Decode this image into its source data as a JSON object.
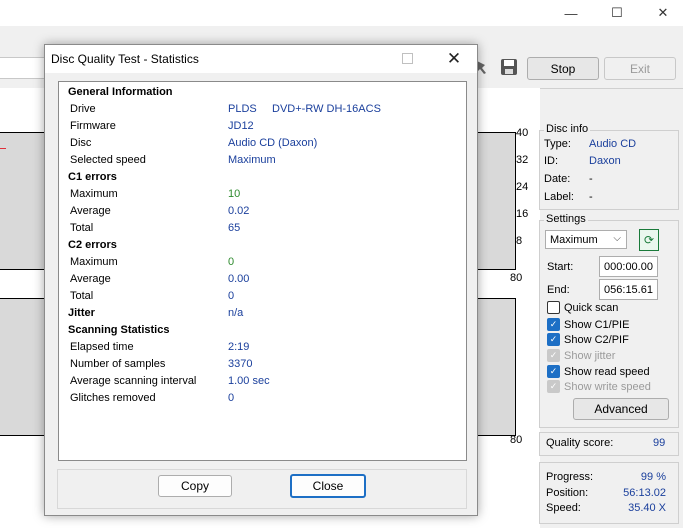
{
  "main_window": {
    "controls": {
      "minimize": "—",
      "maximize": "☐",
      "close": "✕"
    },
    "stop_label": "Stop",
    "exit_label": "Exit",
    "graph_top_ticks": [
      "40",
      "32",
      "24",
      "16",
      "8"
    ],
    "graph_top_bottom": "80",
    "graph_bottom_tick": "80"
  },
  "disc_info": {
    "title": "Disc info",
    "rows": [
      {
        "label": "Type:",
        "value": "Audio CD"
      },
      {
        "label": "ID:",
        "value": "Daxon"
      },
      {
        "label": "Date:",
        "value": "-"
      },
      {
        "label": "Label:",
        "value": "-"
      }
    ]
  },
  "settings": {
    "title": "Settings",
    "speed_selected": "Maximum",
    "start_label": "Start:",
    "start_value": "000:00.00",
    "end_label": "End:",
    "end_value": "056:15.61",
    "quick_scan": "Quick scan",
    "show_c1": "Show C1/PIE",
    "show_c2": "Show C2/PIF",
    "show_jitter": "Show jitter",
    "show_read_speed": "Show read speed",
    "show_write_speed": "Show write speed",
    "advanced_label": "Advanced"
  },
  "quality": {
    "label": "Quality score:",
    "value": "99"
  },
  "progress": {
    "progress_label": "Progress:",
    "progress_value": "99 %",
    "position_label": "Position:",
    "position_value": "56:13.02",
    "speed_label": "Speed:",
    "speed_value": "35.40 X"
  },
  "dialog": {
    "title": "Disc Quality Test - Statistics",
    "close": "✕",
    "general_header": "General Information",
    "drive_label": "Drive",
    "drive_value": "PLDS     DVD+-RW DH-16ACS",
    "firmware_label": "Firmware",
    "firmware_value": "JD12",
    "disc_label": "Disc",
    "disc_value": "Audio CD (Daxon)",
    "speed_label": "Selected speed",
    "speed_value": "Maximum",
    "c1_header": "C1 errors",
    "c1_max_label": "Maximum",
    "c1_max_value": "10",
    "c1_avg_label": "Average",
    "c1_avg_value": "0.02",
    "c1_total_label": "Total",
    "c1_total_value": "65",
    "c2_header": "C2 errors",
    "c2_max_label": "Maximum",
    "c2_max_value": "0",
    "c2_avg_label": "Average",
    "c2_avg_value": "0.00",
    "c2_total_label": "Total",
    "c2_total_value": "0",
    "jitter_label": "Jitter",
    "jitter_value": "n/a",
    "scan_header": "Scanning Statistics",
    "elapsed_label": "Elapsed time",
    "elapsed_value": "2:19",
    "samples_label": "Number of samples",
    "samples_value": "3370",
    "interval_label": "Average scanning interval",
    "interval_value": "1.00 sec",
    "glitches_label": "Glitches removed",
    "glitches_value": "0",
    "copy_label": "Copy",
    "close_label": "Close"
  }
}
